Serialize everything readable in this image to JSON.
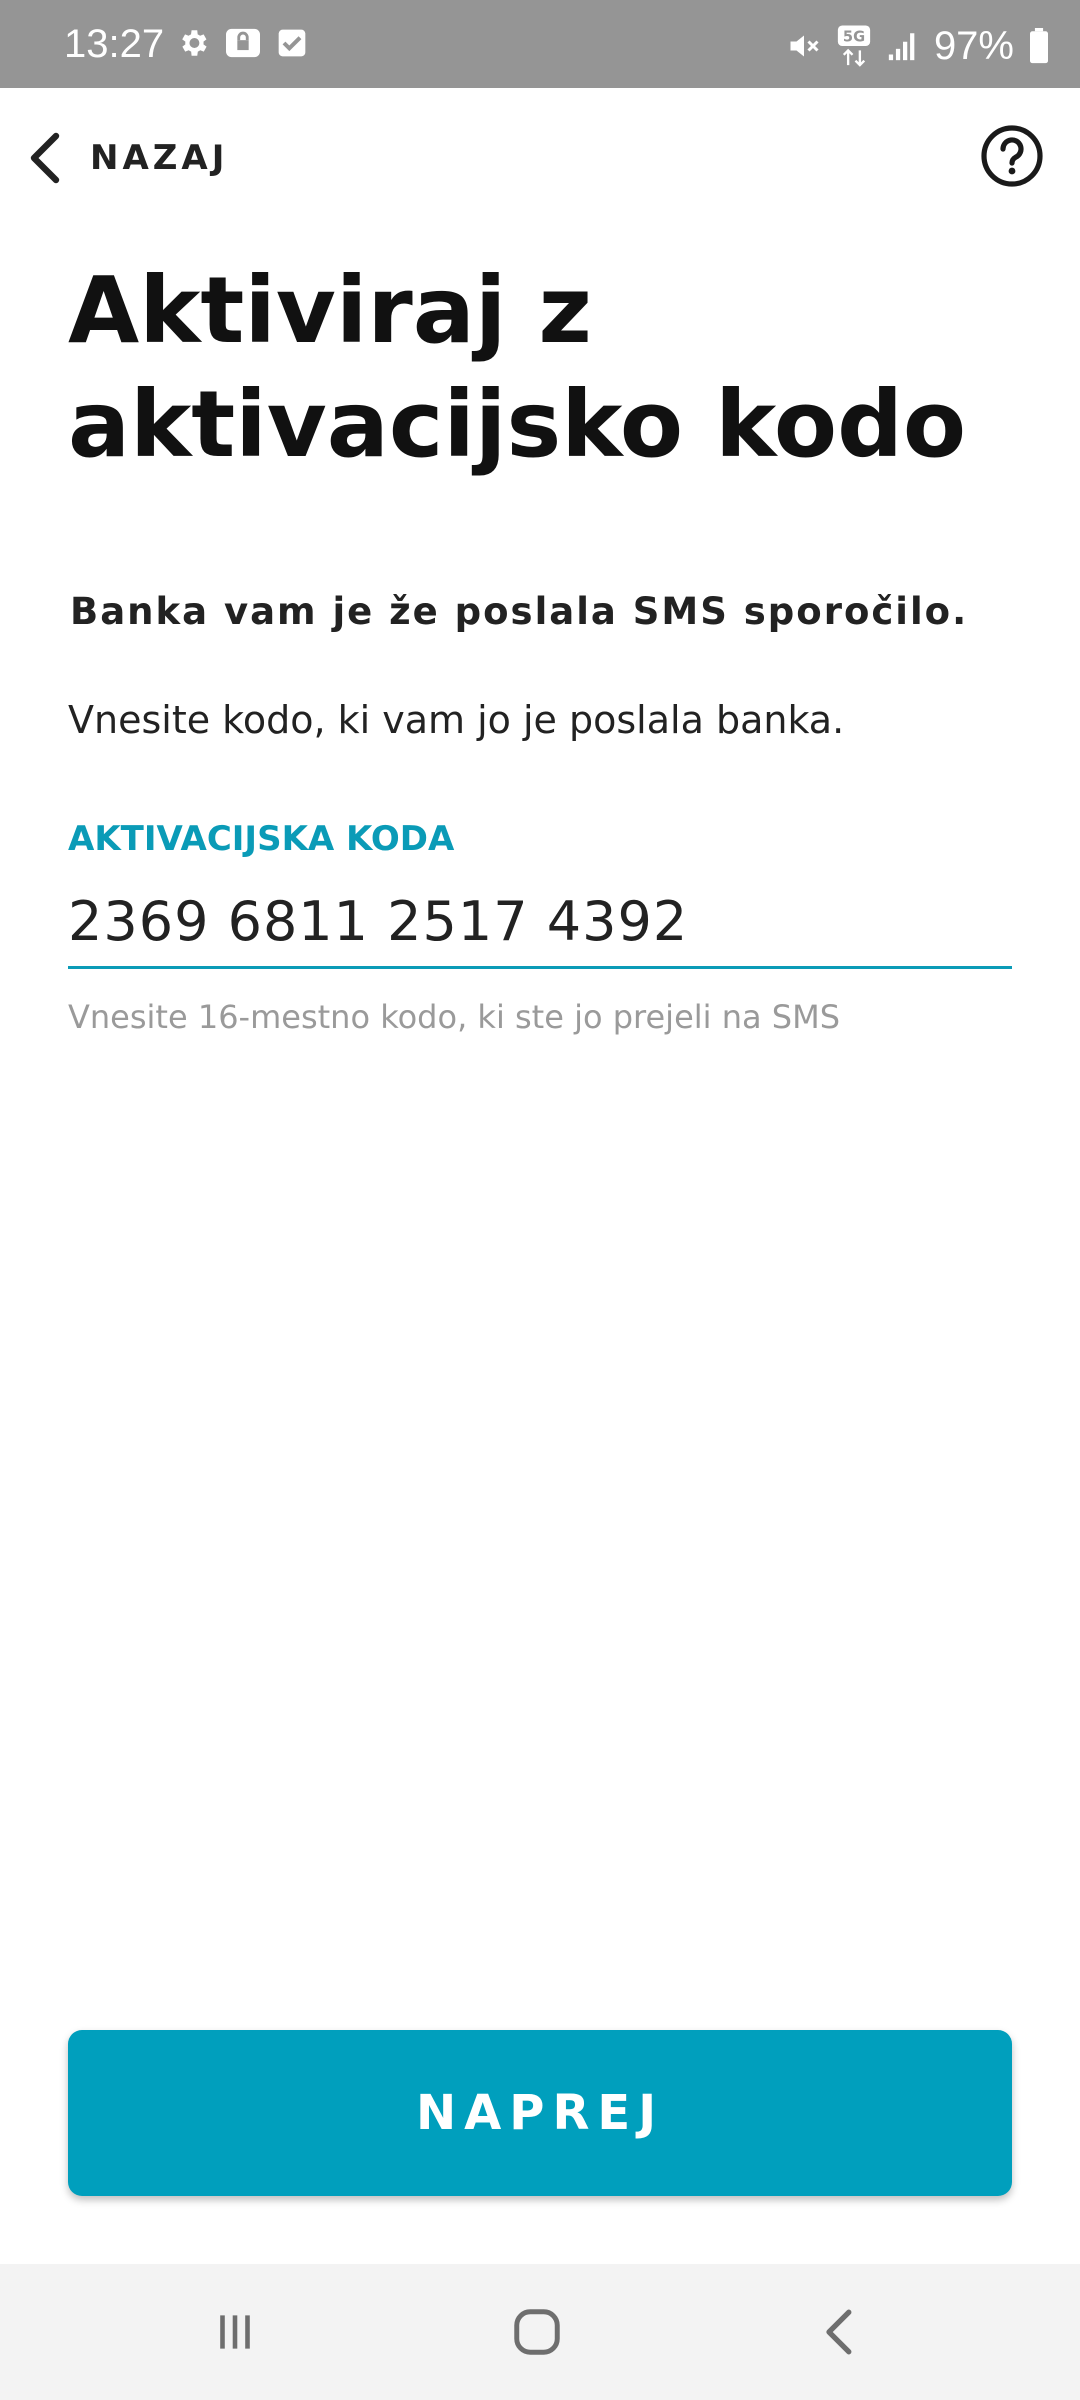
{
  "status_bar": {
    "time": "13:27",
    "battery_text": "97%",
    "network_label": "5G",
    "left_icons": [
      "settings-icon",
      "vpn-lock-icon",
      "checkbox-icon"
    ],
    "right_icons": [
      "mute-icon",
      "5g-icon",
      "signal-icon",
      "battery-icon"
    ]
  },
  "header": {
    "back_label": "NAZAJ",
    "help_icon": "help-circle-icon"
  },
  "main": {
    "title": "Aktiviraj z aktivacijsko kodo",
    "subtitle": "Banka vam je že poslala SMS sporočilo.",
    "instruction": "Vnesite kodo, ki vam jo je poslala banka.",
    "field": {
      "label": "AKTIVACIJSKA KODA",
      "value": "2369 6811 2517 4392",
      "helper": "Vnesite 16-mestno kodo, ki ste jo prejeli na SMS"
    },
    "next_button": "NAPREJ"
  },
  "nav_bar": {
    "buttons": [
      "recents-icon",
      "home-icon",
      "back-icon"
    ]
  },
  "colors": {
    "accent": "#009fbd",
    "status_bar_bg": "#959595",
    "nav_bar_bg": "#f3f3f3",
    "helper_text": "#9a9a9a"
  }
}
